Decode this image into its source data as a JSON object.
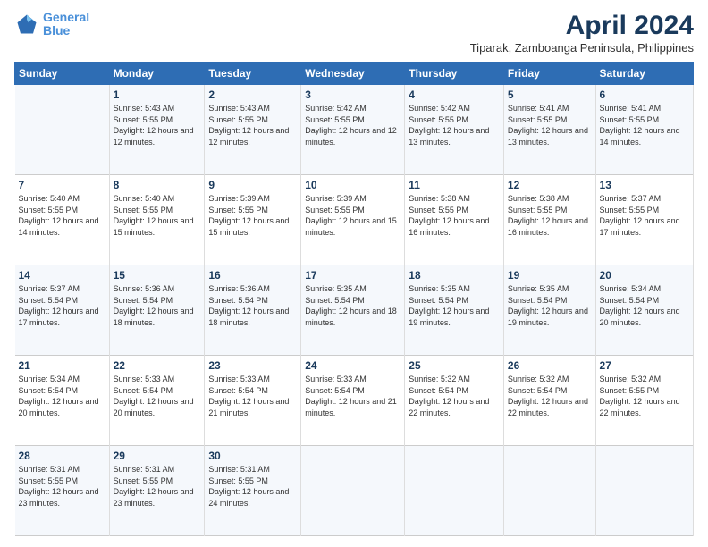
{
  "logo": {
    "line1": "General",
    "line2": "Blue"
  },
  "title": "April 2024",
  "subtitle": "Tiparak, Zamboanga Peninsula, Philippines",
  "header": {
    "days": [
      "Sunday",
      "Monday",
      "Tuesday",
      "Wednesday",
      "Thursday",
      "Friday",
      "Saturday"
    ]
  },
  "weeks": [
    [
      {
        "day": "",
        "sunrise": "",
        "sunset": "",
        "daylight": ""
      },
      {
        "day": "1",
        "sunrise": "Sunrise: 5:43 AM",
        "sunset": "Sunset: 5:55 PM",
        "daylight": "Daylight: 12 hours and 12 minutes."
      },
      {
        "day": "2",
        "sunrise": "Sunrise: 5:43 AM",
        "sunset": "Sunset: 5:55 PM",
        "daylight": "Daylight: 12 hours and 12 minutes."
      },
      {
        "day": "3",
        "sunrise": "Sunrise: 5:42 AM",
        "sunset": "Sunset: 5:55 PM",
        "daylight": "Daylight: 12 hours and 12 minutes."
      },
      {
        "day": "4",
        "sunrise": "Sunrise: 5:42 AM",
        "sunset": "Sunset: 5:55 PM",
        "daylight": "Daylight: 12 hours and 13 minutes."
      },
      {
        "day": "5",
        "sunrise": "Sunrise: 5:41 AM",
        "sunset": "Sunset: 5:55 PM",
        "daylight": "Daylight: 12 hours and 13 minutes."
      },
      {
        "day": "6",
        "sunrise": "Sunrise: 5:41 AM",
        "sunset": "Sunset: 5:55 PM",
        "daylight": "Daylight: 12 hours and 14 minutes."
      }
    ],
    [
      {
        "day": "7",
        "sunrise": "Sunrise: 5:40 AM",
        "sunset": "Sunset: 5:55 PM",
        "daylight": "Daylight: 12 hours and 14 minutes."
      },
      {
        "day": "8",
        "sunrise": "Sunrise: 5:40 AM",
        "sunset": "Sunset: 5:55 PM",
        "daylight": "Daylight: 12 hours and 15 minutes."
      },
      {
        "day": "9",
        "sunrise": "Sunrise: 5:39 AM",
        "sunset": "Sunset: 5:55 PM",
        "daylight": "Daylight: 12 hours and 15 minutes."
      },
      {
        "day": "10",
        "sunrise": "Sunrise: 5:39 AM",
        "sunset": "Sunset: 5:55 PM",
        "daylight": "Daylight: 12 hours and 15 minutes."
      },
      {
        "day": "11",
        "sunrise": "Sunrise: 5:38 AM",
        "sunset": "Sunset: 5:55 PM",
        "daylight": "Daylight: 12 hours and 16 minutes."
      },
      {
        "day": "12",
        "sunrise": "Sunrise: 5:38 AM",
        "sunset": "Sunset: 5:55 PM",
        "daylight": "Daylight: 12 hours and 16 minutes."
      },
      {
        "day": "13",
        "sunrise": "Sunrise: 5:37 AM",
        "sunset": "Sunset: 5:55 PM",
        "daylight": "Daylight: 12 hours and 17 minutes."
      }
    ],
    [
      {
        "day": "14",
        "sunrise": "Sunrise: 5:37 AM",
        "sunset": "Sunset: 5:54 PM",
        "daylight": "Daylight: 12 hours and 17 minutes."
      },
      {
        "day": "15",
        "sunrise": "Sunrise: 5:36 AM",
        "sunset": "Sunset: 5:54 PM",
        "daylight": "Daylight: 12 hours and 18 minutes."
      },
      {
        "day": "16",
        "sunrise": "Sunrise: 5:36 AM",
        "sunset": "Sunset: 5:54 PM",
        "daylight": "Daylight: 12 hours and 18 minutes."
      },
      {
        "day": "17",
        "sunrise": "Sunrise: 5:35 AM",
        "sunset": "Sunset: 5:54 PM",
        "daylight": "Daylight: 12 hours and 18 minutes."
      },
      {
        "day": "18",
        "sunrise": "Sunrise: 5:35 AM",
        "sunset": "Sunset: 5:54 PM",
        "daylight": "Daylight: 12 hours and 19 minutes."
      },
      {
        "day": "19",
        "sunrise": "Sunrise: 5:35 AM",
        "sunset": "Sunset: 5:54 PM",
        "daylight": "Daylight: 12 hours and 19 minutes."
      },
      {
        "day": "20",
        "sunrise": "Sunrise: 5:34 AM",
        "sunset": "Sunset: 5:54 PM",
        "daylight": "Daylight: 12 hours and 20 minutes."
      }
    ],
    [
      {
        "day": "21",
        "sunrise": "Sunrise: 5:34 AM",
        "sunset": "Sunset: 5:54 PM",
        "daylight": "Daylight: 12 hours and 20 minutes."
      },
      {
        "day": "22",
        "sunrise": "Sunrise: 5:33 AM",
        "sunset": "Sunset: 5:54 PM",
        "daylight": "Daylight: 12 hours and 20 minutes."
      },
      {
        "day": "23",
        "sunrise": "Sunrise: 5:33 AM",
        "sunset": "Sunset: 5:54 PM",
        "daylight": "Daylight: 12 hours and 21 minutes."
      },
      {
        "day": "24",
        "sunrise": "Sunrise: 5:33 AM",
        "sunset": "Sunset: 5:54 PM",
        "daylight": "Daylight: 12 hours and 21 minutes."
      },
      {
        "day": "25",
        "sunrise": "Sunrise: 5:32 AM",
        "sunset": "Sunset: 5:54 PM",
        "daylight": "Daylight: 12 hours and 22 minutes."
      },
      {
        "day": "26",
        "sunrise": "Sunrise: 5:32 AM",
        "sunset": "Sunset: 5:54 PM",
        "daylight": "Daylight: 12 hours and 22 minutes."
      },
      {
        "day": "27",
        "sunrise": "Sunrise: 5:32 AM",
        "sunset": "Sunset: 5:55 PM",
        "daylight": "Daylight: 12 hours and 22 minutes."
      }
    ],
    [
      {
        "day": "28",
        "sunrise": "Sunrise: 5:31 AM",
        "sunset": "Sunset: 5:55 PM",
        "daylight": "Daylight: 12 hours and 23 minutes."
      },
      {
        "day": "29",
        "sunrise": "Sunrise: 5:31 AM",
        "sunset": "Sunset: 5:55 PM",
        "daylight": "Daylight: 12 hours and 23 minutes."
      },
      {
        "day": "30",
        "sunrise": "Sunrise: 5:31 AM",
        "sunset": "Sunset: 5:55 PM",
        "daylight": "Daylight: 12 hours and 24 minutes."
      },
      {
        "day": "",
        "sunrise": "",
        "sunset": "",
        "daylight": ""
      },
      {
        "day": "",
        "sunrise": "",
        "sunset": "",
        "daylight": ""
      },
      {
        "day": "",
        "sunrise": "",
        "sunset": "",
        "daylight": ""
      },
      {
        "day": "",
        "sunrise": "",
        "sunset": "",
        "daylight": ""
      }
    ]
  ]
}
